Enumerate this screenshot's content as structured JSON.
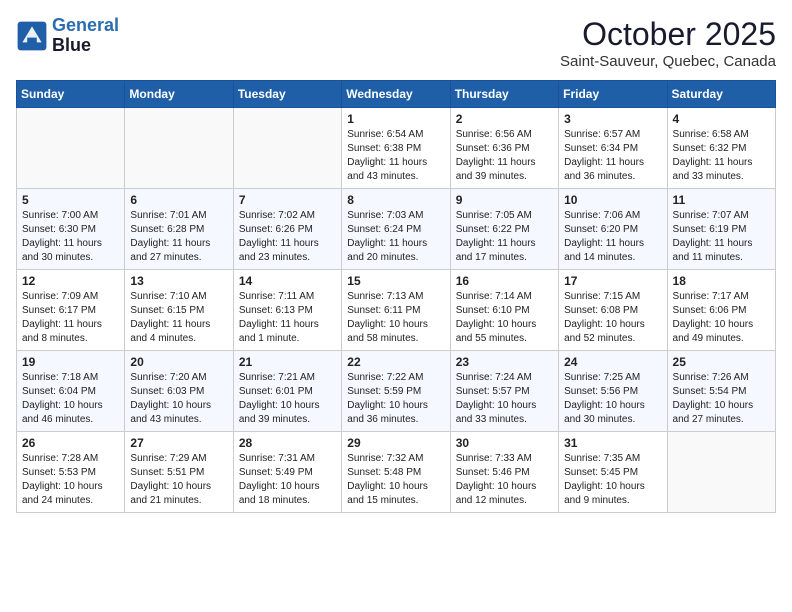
{
  "header": {
    "logo_line1": "General",
    "logo_line2": "Blue",
    "month": "October 2025",
    "location": "Saint-Sauveur, Quebec, Canada"
  },
  "weekdays": [
    "Sunday",
    "Monday",
    "Tuesday",
    "Wednesday",
    "Thursday",
    "Friday",
    "Saturday"
  ],
  "weeks": [
    [
      {
        "day": "",
        "info": ""
      },
      {
        "day": "",
        "info": ""
      },
      {
        "day": "",
        "info": ""
      },
      {
        "day": "1",
        "info": "Sunrise: 6:54 AM\nSunset: 6:38 PM\nDaylight: 11 hours\nand 43 minutes."
      },
      {
        "day": "2",
        "info": "Sunrise: 6:56 AM\nSunset: 6:36 PM\nDaylight: 11 hours\nand 39 minutes."
      },
      {
        "day": "3",
        "info": "Sunrise: 6:57 AM\nSunset: 6:34 PM\nDaylight: 11 hours\nand 36 minutes."
      },
      {
        "day": "4",
        "info": "Sunrise: 6:58 AM\nSunset: 6:32 PM\nDaylight: 11 hours\nand 33 minutes."
      }
    ],
    [
      {
        "day": "5",
        "info": "Sunrise: 7:00 AM\nSunset: 6:30 PM\nDaylight: 11 hours\nand 30 minutes."
      },
      {
        "day": "6",
        "info": "Sunrise: 7:01 AM\nSunset: 6:28 PM\nDaylight: 11 hours\nand 27 minutes."
      },
      {
        "day": "7",
        "info": "Sunrise: 7:02 AM\nSunset: 6:26 PM\nDaylight: 11 hours\nand 23 minutes."
      },
      {
        "day": "8",
        "info": "Sunrise: 7:03 AM\nSunset: 6:24 PM\nDaylight: 11 hours\nand 20 minutes."
      },
      {
        "day": "9",
        "info": "Sunrise: 7:05 AM\nSunset: 6:22 PM\nDaylight: 11 hours\nand 17 minutes."
      },
      {
        "day": "10",
        "info": "Sunrise: 7:06 AM\nSunset: 6:20 PM\nDaylight: 11 hours\nand 14 minutes."
      },
      {
        "day": "11",
        "info": "Sunrise: 7:07 AM\nSunset: 6:19 PM\nDaylight: 11 hours\nand 11 minutes."
      }
    ],
    [
      {
        "day": "12",
        "info": "Sunrise: 7:09 AM\nSunset: 6:17 PM\nDaylight: 11 hours\nand 8 minutes."
      },
      {
        "day": "13",
        "info": "Sunrise: 7:10 AM\nSunset: 6:15 PM\nDaylight: 11 hours\nand 4 minutes."
      },
      {
        "day": "14",
        "info": "Sunrise: 7:11 AM\nSunset: 6:13 PM\nDaylight: 11 hours\nand 1 minute."
      },
      {
        "day": "15",
        "info": "Sunrise: 7:13 AM\nSunset: 6:11 PM\nDaylight: 10 hours\nand 58 minutes."
      },
      {
        "day": "16",
        "info": "Sunrise: 7:14 AM\nSunset: 6:10 PM\nDaylight: 10 hours\nand 55 minutes."
      },
      {
        "day": "17",
        "info": "Sunrise: 7:15 AM\nSunset: 6:08 PM\nDaylight: 10 hours\nand 52 minutes."
      },
      {
        "day": "18",
        "info": "Sunrise: 7:17 AM\nSunset: 6:06 PM\nDaylight: 10 hours\nand 49 minutes."
      }
    ],
    [
      {
        "day": "19",
        "info": "Sunrise: 7:18 AM\nSunset: 6:04 PM\nDaylight: 10 hours\nand 46 minutes."
      },
      {
        "day": "20",
        "info": "Sunrise: 7:20 AM\nSunset: 6:03 PM\nDaylight: 10 hours\nand 43 minutes."
      },
      {
        "day": "21",
        "info": "Sunrise: 7:21 AM\nSunset: 6:01 PM\nDaylight: 10 hours\nand 39 minutes."
      },
      {
        "day": "22",
        "info": "Sunrise: 7:22 AM\nSunset: 5:59 PM\nDaylight: 10 hours\nand 36 minutes."
      },
      {
        "day": "23",
        "info": "Sunrise: 7:24 AM\nSunset: 5:57 PM\nDaylight: 10 hours\nand 33 minutes."
      },
      {
        "day": "24",
        "info": "Sunrise: 7:25 AM\nSunset: 5:56 PM\nDaylight: 10 hours\nand 30 minutes."
      },
      {
        "day": "25",
        "info": "Sunrise: 7:26 AM\nSunset: 5:54 PM\nDaylight: 10 hours\nand 27 minutes."
      }
    ],
    [
      {
        "day": "26",
        "info": "Sunrise: 7:28 AM\nSunset: 5:53 PM\nDaylight: 10 hours\nand 24 minutes."
      },
      {
        "day": "27",
        "info": "Sunrise: 7:29 AM\nSunset: 5:51 PM\nDaylight: 10 hours\nand 21 minutes."
      },
      {
        "day": "28",
        "info": "Sunrise: 7:31 AM\nSunset: 5:49 PM\nDaylight: 10 hours\nand 18 minutes."
      },
      {
        "day": "29",
        "info": "Sunrise: 7:32 AM\nSunset: 5:48 PM\nDaylight: 10 hours\nand 15 minutes."
      },
      {
        "day": "30",
        "info": "Sunrise: 7:33 AM\nSunset: 5:46 PM\nDaylight: 10 hours\nand 12 minutes."
      },
      {
        "day": "31",
        "info": "Sunrise: 7:35 AM\nSunset: 5:45 PM\nDaylight: 10 hours\nand 9 minutes."
      },
      {
        "day": "",
        "info": ""
      }
    ]
  ]
}
